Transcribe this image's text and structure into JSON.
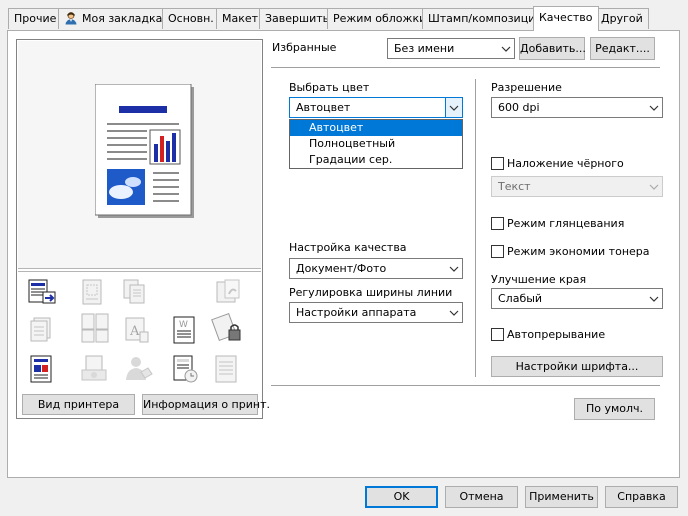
{
  "tabs": [
    {
      "label": "Прочие"
    },
    {
      "label": "Моя закладка"
    },
    {
      "label": "Основн."
    },
    {
      "label": "Макет"
    },
    {
      "label": "Завершить"
    },
    {
      "label": "Режим обложки"
    },
    {
      "label": "Штамп/композиция"
    },
    {
      "label": "Качество"
    },
    {
      "label": "Другой"
    }
  ],
  "favorites": {
    "label": "Избранные",
    "value": "Без имени",
    "add_label": "Добавить...",
    "edit_label": "Редакт...."
  },
  "left": {
    "printer_view_label": "Вид принтера",
    "printer_info_label": "Информация о принт."
  },
  "color": {
    "label": "Выбрать цвет",
    "value": "Автоцвет",
    "options": [
      "Автоцвет",
      "Полноцветный",
      "Градации сер."
    ],
    "selected_index": 0
  },
  "quality": {
    "label": "Настройка качества",
    "value": "Документ/Фото"
  },
  "line_width": {
    "label": "Регулировка ширины линии",
    "value": "Настройки аппарата"
  },
  "resolution": {
    "label": "Разрешение",
    "value": "600 dpi"
  },
  "black_overprint": {
    "label": "Наложение чёрного",
    "checked": false,
    "sub_value": "Текст"
  },
  "glossy": {
    "label": "Режим глянцевания",
    "checked": false
  },
  "toner_save": {
    "label": "Режим экономии тонера",
    "checked": false
  },
  "edge": {
    "label": "Улучшение края",
    "value": "Слабый"
  },
  "auto_trap": {
    "label": "Автопрерывание",
    "checked": false
  },
  "font_settings_label": "Настройки шрифта...",
  "default_label": "По умолч.",
  "footer": {
    "ok": "OK",
    "cancel": "Отмена",
    "apply": "Применить",
    "help": "Справка"
  }
}
